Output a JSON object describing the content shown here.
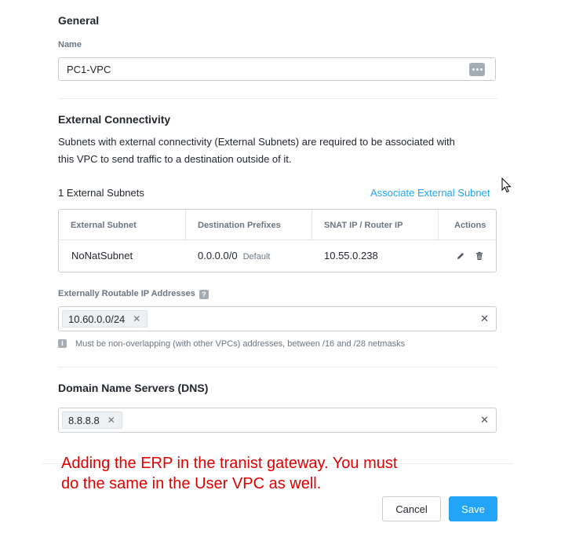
{
  "general": {
    "title": "General",
    "name_label": "Name",
    "name_value": "PC1-VPC"
  },
  "external": {
    "title": "External Connectivity",
    "description_line1": "Subnets with external connectivity (External Subnets) are required to be associated with",
    "description_line2": "this VPC to send traffic to a destination outside of it.",
    "count_label": "1 External Subnets",
    "associate_link": "Associate External Subnet",
    "table": {
      "headers": [
        "External Subnet",
        "Destination Prefixes",
        "SNAT IP / Router IP",
        "Actions"
      ],
      "rows": [
        {
          "subnet": "NoNatSubnet",
          "prefix": "0.0.0.0/0",
          "prefix_tag": "Default",
          "snat_ip": "10.55.0.238"
        }
      ]
    }
  },
  "erp": {
    "label": "Externally Routable IP Addresses",
    "help": "?",
    "tags": [
      "10.60.0.0/24"
    ],
    "hint_icon": "i",
    "hint": "Must be non-overlapping (with other VPCs) addresses, between /16 and /28 netmasks"
  },
  "dns": {
    "title": "Domain Name Servers (DNS)",
    "tags": [
      "8.8.8.8"
    ]
  },
  "annotation": {
    "line1": "Adding the ERP in the tranist gateway. You must",
    "line2": "do the same in the User VPC as well."
  },
  "buttons": {
    "cancel": "Cancel",
    "save": "Save"
  },
  "icons": {
    "more": "more-dots-icon",
    "edit": "pencil-icon",
    "delete": "trash-icon",
    "remove": "close-icon",
    "cursor": "mouse-cursor-icon"
  },
  "colors": {
    "accent": "#22a5f7",
    "annotation": "#e00000",
    "text": "#22272e",
    "muted": "#6b7682"
  }
}
